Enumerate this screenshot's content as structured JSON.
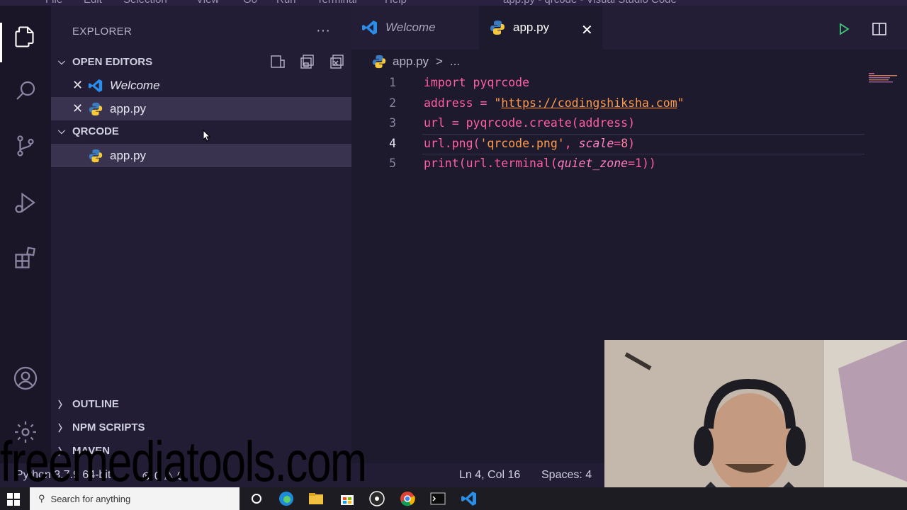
{
  "titlebar": {
    "menus": [
      "File",
      "Edit",
      "Selection",
      "View",
      "Go",
      "Run",
      "Terminal",
      "Help"
    ],
    "title": "app.py - qrcode - Visual Studio Code"
  },
  "activity_bar": {
    "items": [
      "files-icon",
      "search-icon",
      "source-control-icon",
      "run-debug-icon",
      "extensions-icon"
    ],
    "bottom": [
      "account-icon",
      "settings-gear-icon"
    ]
  },
  "sidebar": {
    "title": "EXPLORER",
    "more": "···",
    "open_editors": {
      "label": "OPEN EDITORS",
      "items": [
        {
          "label": "Welcome",
          "icon": "vscode-icon"
        },
        {
          "label": "app.py",
          "icon": "python-icon"
        }
      ]
    },
    "folder": {
      "label": "QRCODE",
      "items": [
        {
          "label": "app.py",
          "icon": "python-icon"
        }
      ]
    },
    "outline": "OUTLINE",
    "npm_scripts": "NPM SCRIPTS",
    "maven": "MAVEN"
  },
  "tabs": [
    {
      "label": "Welcome",
      "icon": "vscode-icon",
      "active": false
    },
    {
      "label": "app.py",
      "icon": "python-icon",
      "active": true
    }
  ],
  "breadcrumb": {
    "file": "app.py",
    "sep": ">",
    "rest": "..."
  },
  "code": {
    "line_numbers": [
      "1",
      "2",
      "3",
      "4",
      "5"
    ],
    "current_line": 4,
    "l1_kw": "import",
    "l1_mod": " pyqrcode",
    "l2_var": "address",
    "l2_eq": " = ",
    "l2_q1": "\"",
    "l2_url": "https://codingshiksha.com",
    "l2_q2": "\"",
    "l3_var": "url",
    "l3_eq": " = ",
    "l3_call": "pyqrcode.create(address)",
    "l4_call": "url.png(",
    "l4_str": "'qrcode.png'",
    "l4_comma": ", ",
    "l4_param": "scale",
    "l4_eq": "=",
    "l4_num": "8",
    "l4_close": ")",
    "l5_fn": "print(url.terminal(",
    "l5_param": "quiet_zone",
    "l5_eq": "=",
    "l5_num": "1",
    "l5_close": "))"
  },
  "statusbar": {
    "python": "Python 3.7.9 64-bit",
    "errors": "0",
    "warnings": "0",
    "position": "Ln 4, Col 16",
    "spaces": "Spaces: 4"
  },
  "taskbar": {
    "search_placeholder": "Search for anything"
  },
  "watermark": "freemediatools.com"
}
